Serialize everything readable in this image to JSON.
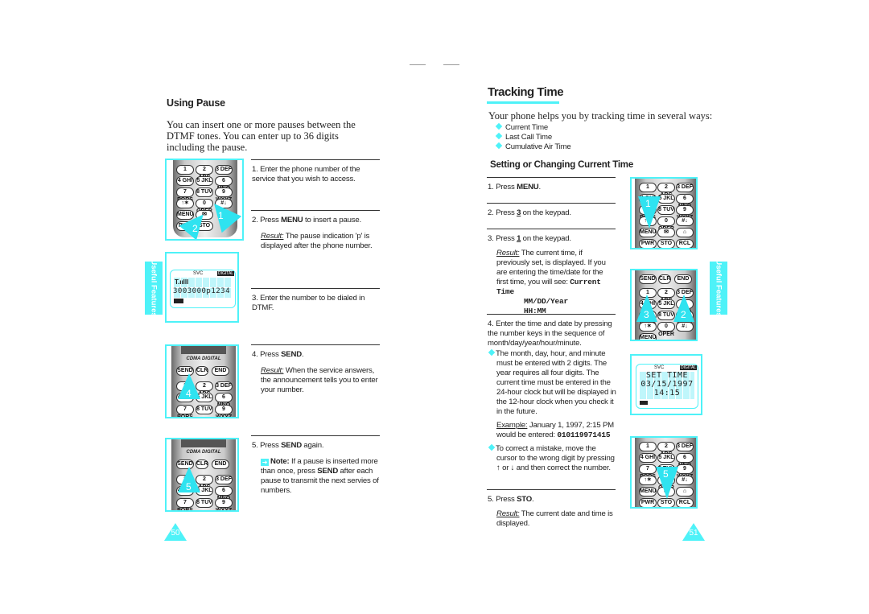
{
  "left_page": {
    "section_title": "Using Pause",
    "intro": "You can insert one or more pauses between the DTMF tones. You can enter up to 36 digits including the pause.",
    "steps": [
      {
        "number": "1.",
        "text": "Enter the phone number of the service that you wish to access."
      },
      {
        "number": "2.",
        "pre": "Press ",
        "key": "MENU",
        "post": " to insert a pause.",
        "result_label": "Result:",
        "result_text": " The pause indication 'p' is displayed after the phone number."
      },
      {
        "number": "3.",
        "text": "Enter the number to be dialed in DTMF."
      },
      {
        "number": "4.",
        "pre": "Press ",
        "key": "SEND",
        "post": ".",
        "result_label": "Result:",
        "result_text": " When the service answers, the announcement tells you to enter your number."
      },
      {
        "number": "5.",
        "pre": "Press ",
        "key": "SEND",
        "post": " again.",
        "note_label": "Note:",
        "note_pre": " If a pause is inserted more than once, press ",
        "note_key": "SEND",
        "note_post": " after each pause to transmit the next servies of numbers."
      }
    ],
    "display": {
      "svc": "SVC",
      "digital": "DIGITAL",
      "number": "3003000p1234"
    },
    "callouts": [
      "1",
      "2",
      "4",
      "5"
    ],
    "phone_brand": "CDMA DIGITAL",
    "side_tab": "Useful Features",
    "page_number": "50"
  },
  "right_page": {
    "title": "Tracking Time",
    "intro": "Your phone helps you by tracking time in several ways:",
    "bullets": [
      "Current Time",
      "Last Call Time",
      "Cumulative Air Time"
    ],
    "section_title": "Setting or Changing Current Time",
    "steps": [
      {
        "number": "1.",
        "pre": "Press ",
        "key": "MENU",
        "post": "."
      },
      {
        "number": "2.",
        "pre": "Press ",
        "key": "3",
        "post": " on the keypad."
      },
      {
        "number": "3.",
        "pre": "Press ",
        "key": "1",
        "post": " on the keypad.",
        "result_label": "Result:",
        "result_text": " The current time, if previously set, is displayed. If you are entering the time/date for the first time, you will see: ",
        "code_lines": [
          "Current Time",
          "MM/DD/Year",
          "HH:MM"
        ]
      },
      {
        "number": "4.",
        "text": "Enter the time and date by pressing the number keys in the sequence of month/day/year/hour/minute.",
        "bullet1": "The month, day, hour, and minute must be entered with 2 digits. The year requires all four digits. The current time must be entered in the 24-hour clock but will be displayed in the 12-hour clock when you check it in the future.",
        "example_label": "Example:",
        "example_text": " January 1, 1997, 2:15 PM would be entered: ",
        "example_code": "010119971415",
        "bullet2_pre": "To correct a mistake, move the cursor to the wrong digit by pressing ",
        "up_arrow": "↑",
        "bullet2_mid": " or ",
        "down_arrow": "↓",
        "bullet2_post": " and then correct the number."
      },
      {
        "number": "5.",
        "pre": "Press ",
        "key": "STO",
        "post": ".",
        "result_label": "Result:",
        "result_text": " The current date and time is displayed."
      }
    ],
    "display": {
      "svc": "SVC",
      "digital": "DIGITAL",
      "line1": "SET TIME",
      "line2": "03/15/1997",
      "line3": "14:15"
    },
    "callouts": [
      "1",
      "3",
      "2",
      "5"
    ],
    "side_tab": "Useful Features",
    "page_number": "51"
  },
  "keys": {
    "row1": [
      "1",
      "2 ABC",
      "3 DEF"
    ],
    "row2": [
      "4 GHI",
      "5 JKL",
      "6 MNO"
    ],
    "row3": [
      "7 PQRS",
      "8 TUV",
      "9 WXYZ"
    ],
    "row4": [
      "↑✶",
      "0 OPER",
      "#↓"
    ],
    "row5": [
      "MENU",
      "✉",
      "⌂"
    ],
    "row6": [
      "PWR",
      "STO",
      "RCL"
    ],
    "send_row": [
      "SEND",
      "CLR",
      "END"
    ]
  },
  "colors": {
    "accent": "#4ef2f8"
  }
}
